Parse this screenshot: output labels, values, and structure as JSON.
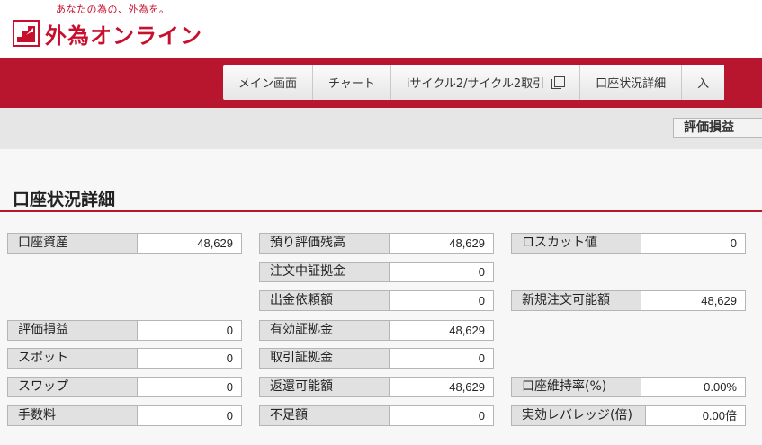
{
  "header": {
    "tagline": "あなたの為の、外為を。",
    "logo_text": "外為オンライン"
  },
  "nav": {
    "items": [
      {
        "label": "メイン画面"
      },
      {
        "label": "チャート"
      },
      {
        "label": "iサイクル2/サイクル2取引"
      },
      {
        "label": "口座状況詳細"
      },
      {
        "label": "入"
      }
    ]
  },
  "subnav": {
    "tab": "評価損益"
  },
  "page": {
    "title": "口座状況詳細"
  },
  "fields": {
    "account_assets": {
      "label": "口座資産",
      "value": "48,629"
    },
    "deposit_valuation": {
      "label": "預り評価残高",
      "value": "48,629"
    },
    "losscut_value": {
      "label": "ロスカット値",
      "value": "0"
    },
    "order_margin": {
      "label": "注文中証拠金",
      "value": "0"
    },
    "withdrawal_request": {
      "label": "出金依頼額",
      "value": "0"
    },
    "new_order_available": {
      "label": "新規注文可能額",
      "value": "48,629"
    },
    "valuation_pl": {
      "label": "評価損益",
      "value": "0"
    },
    "effective_margin": {
      "label": "有効証拠金",
      "value": "48,629"
    },
    "spot": {
      "label": "スポット",
      "value": "0"
    },
    "trade_margin": {
      "label": "取引証拠金",
      "value": "0"
    },
    "swap": {
      "label": "スワップ",
      "value": "0"
    },
    "returnable": {
      "label": "返還可能額",
      "value": "48,629"
    },
    "maintenance_rate": {
      "label": "口座維持率(%)",
      "value": "0.00%"
    },
    "fee": {
      "label": "手数料",
      "value": "0"
    },
    "shortfall": {
      "label": "不足額",
      "value": "0"
    },
    "effective_leverage": {
      "label": "実効レバレッジ(倍)",
      "value": "0.00倍"
    }
  },
  "colors": {
    "brand_red": "#b8152f",
    "logo_red": "#c8102e"
  }
}
